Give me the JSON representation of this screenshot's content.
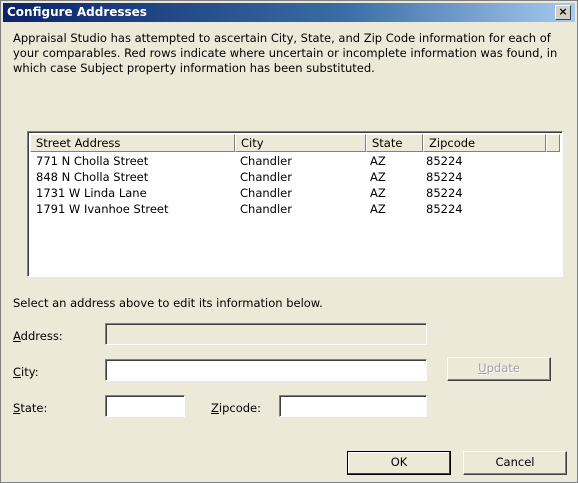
{
  "window": {
    "title": "Configure Addresses",
    "close_glyph": "×"
  },
  "description": "Appraisal Studio has attempted to ascertain City, State, and Zip Code information for each of your comparables.  Red rows indicate where uncertain or incomplete information was found, in which case Subject property information has been substituted.",
  "list": {
    "columns": [
      "Street Address",
      "City",
      "State",
      "Zipcode"
    ],
    "rows": [
      [
        "771 N Cholla Street",
        "Chandler",
        "AZ",
        "85224"
      ],
      [
        "848 N Cholla Street",
        "Chandler",
        "AZ",
        "85224"
      ],
      [
        "1731 W Linda Lane",
        "Chandler",
        "AZ",
        "85224"
      ],
      [
        "1791 W Ivanhoe Street",
        "Chandler",
        "AZ",
        "85224"
      ]
    ]
  },
  "edit": {
    "hint": "Select an address above to edit its information below.",
    "address_label_accel": "A",
    "address_label_rest": "ddress:",
    "city_label_accel": "C",
    "city_label_rest": "ity:",
    "state_label_accel": "S",
    "state_label_rest": "tate:",
    "zipcode_label_accel": "Z",
    "zipcode_label_rest": "ipcode:",
    "address_value": "",
    "city_value": "",
    "state_value": "",
    "zipcode_value": "",
    "update_label_accel": "U",
    "update_label_rest": "pdate"
  },
  "buttons": {
    "ok": "OK",
    "cancel": "Cancel"
  },
  "colors": {
    "title_gradient_start": "#0a246a",
    "title_gradient_end": "#a6caf0",
    "window_bg": "#ece9d8"
  }
}
